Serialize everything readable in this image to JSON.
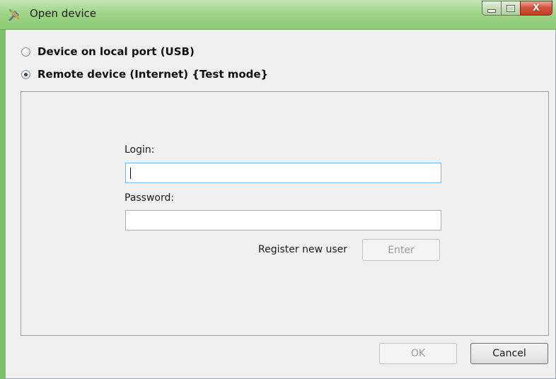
{
  "window": {
    "title": "Open device",
    "title_icon": "tools-icon",
    "close_glyph": "X",
    "accent": "#8ccb73"
  },
  "connection": {
    "options": [
      {
        "label": "Device on local port (USB)",
        "checked": false
      },
      {
        "label": "Remote device (Internet) {Test mode}",
        "checked": true
      }
    ]
  },
  "login_form": {
    "login_label": "Login:",
    "login_value": "",
    "password_label": "Password:",
    "password_value": "",
    "register_label": "Register new user",
    "enter_label": "Enter"
  },
  "footer": {
    "ok_label": "OK",
    "cancel_label": "Cancel"
  }
}
